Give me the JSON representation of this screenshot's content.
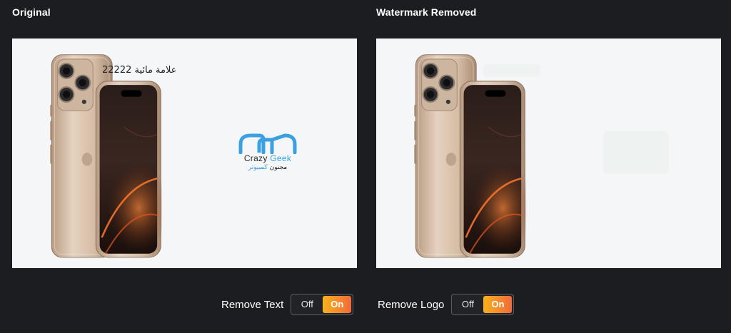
{
  "panels": {
    "original": {
      "title": "Original"
    },
    "removed": {
      "title": "Watermark Removed"
    }
  },
  "watermark": {
    "text": "علامة مائية 22222",
    "logo_name_main": "Crazy ",
    "logo_name_accent": "Geek",
    "logo_sub_main": "مجنون ",
    "logo_sub_accent": "كمبيوتر"
  },
  "controls": {
    "remove_text": {
      "label": "Remove Text",
      "off_label": "Off",
      "on_label": "On",
      "state": "on"
    },
    "remove_logo": {
      "label": "Remove Logo",
      "off_label": "Off",
      "on_label": "On",
      "state": "on"
    }
  },
  "colors": {
    "background": "#1c1d20",
    "image_background": "#f5f6f8",
    "toggle_on_start": "#f7b21b",
    "toggle_on_end": "#f26a3a",
    "logo_accent": "#3aa0e2"
  }
}
